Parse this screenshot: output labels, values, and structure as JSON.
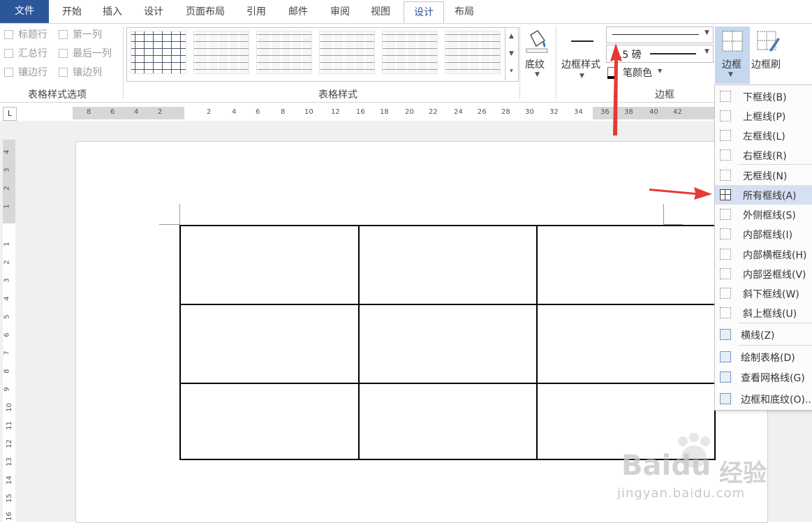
{
  "tabs": {
    "file": "文件",
    "home": "开始",
    "insert": "插入",
    "design1": "设计",
    "layout": "页面布局",
    "references": "引用",
    "mailings": "邮件",
    "review": "审阅",
    "view": "视图",
    "design2": "设计",
    "layout2": "布局"
  },
  "table_style_options": {
    "header_row": "标题行",
    "first_col": "第一列",
    "total_row": "汇总行",
    "last_col": "最后一列",
    "banded_rows": "镶边行",
    "banded_cols": "镶边列",
    "group_label": "表格样式选项"
  },
  "table_styles": {
    "group_label": "表格样式"
  },
  "shading": {
    "label": "底纹"
  },
  "borders_group": {
    "border_styles": "边框样式",
    "weight": "1.5 磅",
    "pen_color": "笔颜色",
    "group_label": "边框",
    "borders_button": "边框",
    "border_painter": "边框刷"
  },
  "hruler": [
    "8",
    "6",
    "4",
    "2",
    "2",
    "4",
    "6",
    "8",
    "10",
    "12",
    "16",
    "18",
    "20",
    "22",
    "24",
    "26",
    "28",
    "30",
    "32",
    "34",
    "36",
    "38",
    "40",
    "42"
  ],
  "vruler": [
    "4",
    "3",
    "2",
    "1",
    "1",
    "2",
    "3",
    "4",
    "5",
    "6",
    "7",
    "8",
    "9",
    "10",
    "11",
    "12",
    "13",
    "14",
    "15",
    "16"
  ],
  "menu": {
    "items": [
      "下框线(B)",
      "上框线(P)",
      "左框线(L)",
      "右框线(R)",
      "无框线(N)",
      "所有框线(A)",
      "外侧框线(S)",
      "内部框线(I)",
      "内部横框线(H)",
      "内部竖框线(V)",
      "斜下框线(W)",
      "斜上框线(U)",
      "横线(Z)",
      "绘制表格(D)",
      "查看网格线(G)",
      "边框和底纹(O)..."
    ]
  },
  "watermark": {
    "brand": "Baidu",
    "cn": "经验",
    "url": "jingyan.baidu.com"
  },
  "colors": {
    "accent": "#2b579a",
    "arrow": "#e53935",
    "highlight": "#d5e1f2"
  }
}
